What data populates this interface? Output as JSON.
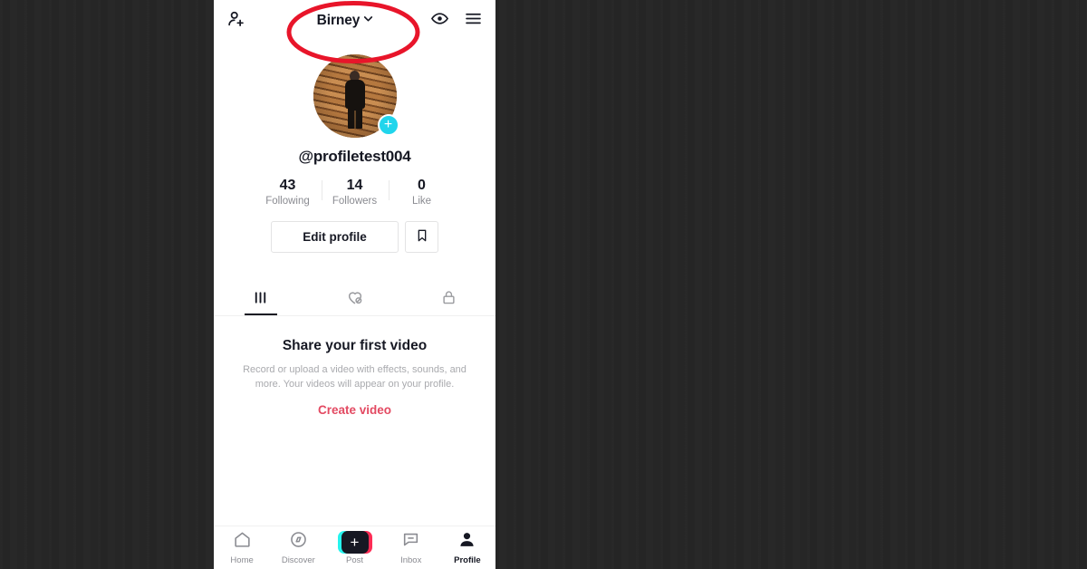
{
  "app": {
    "name": "TikTok",
    "background_color": "#262626",
    "panel_color": "#ffffff"
  },
  "annotation": {
    "shape": "ellipse",
    "color": "#e8152a",
    "target": "account-switcher"
  },
  "topbar": {
    "add_friends_icon": "person-add-icon",
    "username": "Birney",
    "chevron_icon": "chevron-down-icon",
    "views_icon": "eye-icon",
    "menu_icon": "hamburger-menu-icon"
  },
  "profile": {
    "avatar_alt": "person standing in front of wooden slat wall",
    "add_badge": "+",
    "add_badge_color": "#20D5EC",
    "handle": "@profiletest004",
    "bio": "",
    "stats": [
      {
        "value": "43",
        "label": "Following"
      },
      {
        "value": "14",
        "label": "Followers"
      },
      {
        "value": "0",
        "label": "Like"
      }
    ],
    "edit_profile_label": "Edit profile",
    "bookmark_icon": "bookmark-icon"
  },
  "tabs": [
    {
      "id": "videos",
      "icon": "grid-posts-icon",
      "active": true
    },
    {
      "id": "liked",
      "icon": "heart-hidden-icon",
      "active": false
    },
    {
      "id": "private",
      "icon": "lock-icon",
      "active": false
    }
  ],
  "empty_state": {
    "title": "Share your first video",
    "description": "Record or upload a video with effects, sounds, and more. Your videos will appear on your profile.",
    "cta_label": "Create video",
    "cta_color": "#e34a62"
  },
  "bottom_nav": [
    {
      "id": "home",
      "label": "Home",
      "icon": "home-icon",
      "active": false
    },
    {
      "id": "discover",
      "label": "Discover",
      "icon": "compass-icon",
      "active": false
    },
    {
      "id": "post",
      "label": "Post",
      "icon": "plus-icon",
      "active": false
    },
    {
      "id": "inbox",
      "label": "Inbox",
      "icon": "message-icon",
      "active": false
    },
    {
      "id": "profile",
      "label": "Profile",
      "icon": "person-icon",
      "active": true
    }
  ]
}
